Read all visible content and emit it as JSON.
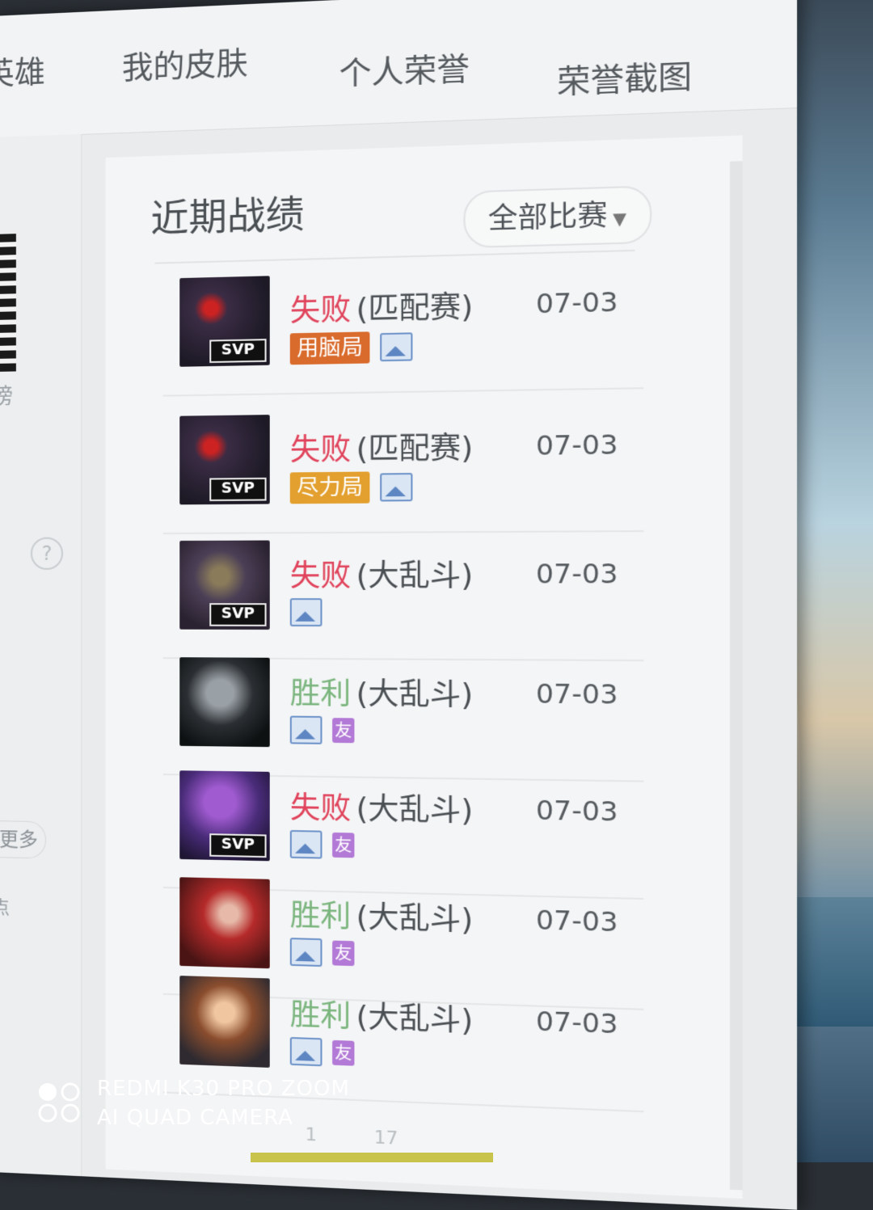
{
  "nav": {
    "tabs": [
      {
        "label": "英雄"
      },
      {
        "label": "我的皮肤"
      },
      {
        "label": "个人荣誉"
      },
      {
        "label": "荣誉截图"
      }
    ]
  },
  "left": {
    "rank_text": "榜",
    "help": "?",
    "more_label": "更多",
    "stub": "点"
  },
  "recent": {
    "title": "近期战绩",
    "filter_label": "全部比赛",
    "matches": [
      {
        "result": "失败",
        "mode": "(匹配赛)",
        "date": "07-03",
        "svp": "SVP",
        "tag": "用脑局",
        "tag_color": "orange",
        "friend": false,
        "win": false
      },
      {
        "result": "失败",
        "mode": "(匹配赛)",
        "date": "07-03",
        "svp": "SVP",
        "tag": "尽力局",
        "tag_color": "yellow",
        "friend": false,
        "win": false
      },
      {
        "result": "失败",
        "mode": "(大乱斗)",
        "date": "07-03",
        "svp": "SVP",
        "tag": "",
        "friend": false,
        "win": false
      },
      {
        "result": "胜利",
        "mode": "(大乱斗)",
        "date": "07-03",
        "svp": "",
        "tag": "",
        "friend": true,
        "win": true
      },
      {
        "result": "失败",
        "mode": "(大乱斗)",
        "date": "07-03",
        "svp": "SVP",
        "tag": "",
        "friend": true,
        "win": false
      },
      {
        "result": "胜利",
        "mode": "(大乱斗)",
        "date": "07-03",
        "svp": "",
        "tag": "",
        "friend": true,
        "win": true
      },
      {
        "result": "胜利",
        "mode": "(大乱斗)",
        "date": "07-03",
        "svp": "",
        "tag": "",
        "friend": true,
        "win": true
      }
    ],
    "friend_label": "友"
  },
  "pager": {
    "current": "1",
    "total": "17"
  },
  "watermark": {
    "line1": "REDMI K30 PRO ZOOM",
    "line2": "AI QUAD CAMERA"
  },
  "colors": {
    "loss": "#e0435b",
    "win": "#7bb57e"
  }
}
